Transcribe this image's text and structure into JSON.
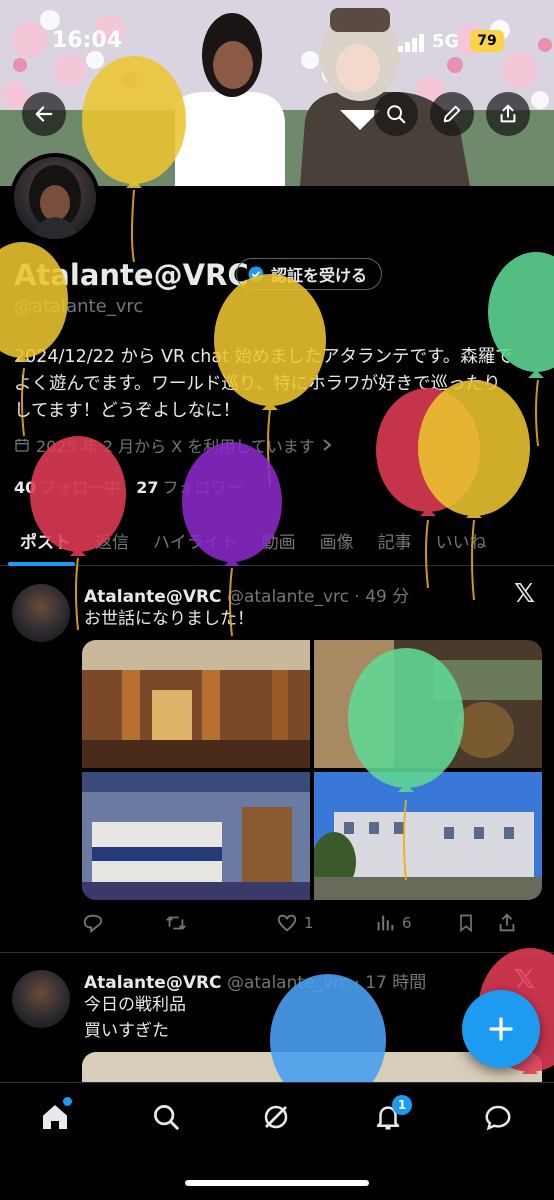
{
  "status_bar": {
    "time": "16:04",
    "network": "5G",
    "battery": "79"
  },
  "profile": {
    "display_name": "Atalante@VRC",
    "verify_label": "認証を受ける",
    "handle": "@atalante_vrc",
    "bio_lines": [
      "2024/12/22 から VR chat 始めましたアタランテです。森羅で",
      "よく遊んでます。ワールド巡り、特にホラワが好きで巡ったり",
      "してます！どうぞよしなに！"
    ],
    "joined": "2025 年 2 月から X を利用しています",
    "following_count": "40",
    "following_label": "フォロー中",
    "followers_count": "27",
    "followers_label": "フォロワー"
  },
  "tabs": [
    "ポスト",
    "返信",
    "ハイライト",
    "動画",
    "画像",
    "記事",
    "いいね"
  ],
  "posts": [
    {
      "name": "Atalante@VRC",
      "meta": "@atalante_vrc · 49 分",
      "lines": [
        "お世話になりました！"
      ],
      "likes": "1",
      "views": "6"
    },
    {
      "name": "Atalante@VRC",
      "meta": "@atalante_vrc · 17 時間",
      "lines": [
        "今日の戦利品",
        "買いすぎた"
      ]
    }
  ],
  "notifications_badge": "1",
  "colors": {
    "accent": "#1d9bf0",
    "background": "#000000",
    "muted": "#71767b"
  },
  "icons": [
    "back-arrow-icon",
    "search-icon",
    "pencil-icon",
    "share-icon",
    "calendar-icon",
    "chevron-right-icon",
    "reply-icon",
    "retweet-icon",
    "heart-icon",
    "views-icon",
    "bookmark-icon",
    "share-icon",
    "home-icon",
    "search-icon",
    "grok-icon",
    "bell-icon",
    "messages-icon",
    "plus-icon",
    "x-logo-icon"
  ]
}
